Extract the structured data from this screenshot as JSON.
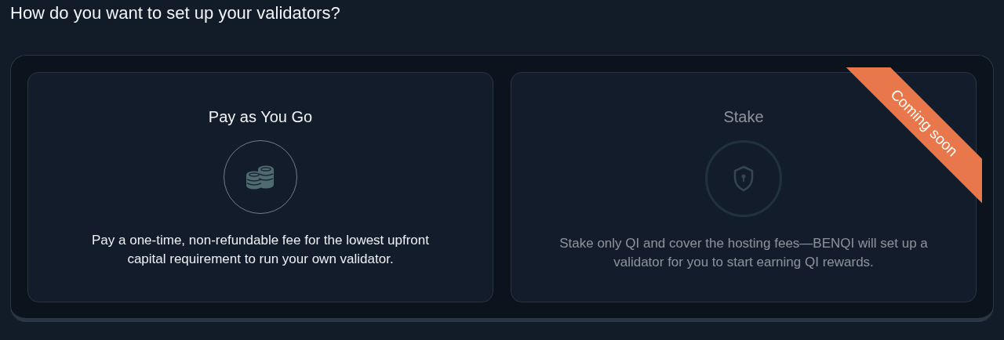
{
  "heading": "How do you want to set up your validators?",
  "options": [
    {
      "title": "Pay as You Go",
      "kind": "coins",
      "description": "Pay a one-time, non-refundable fee for the lowest upfront capital requirement to run your own validator.",
      "disabled": false
    },
    {
      "title": "Stake",
      "kind": "shield",
      "description": "Stake only QI and cover the hosting fees—BENQI will set up a validator for you to start earning QI rewards.",
      "disabled": true,
      "badge": "Coming soon"
    }
  ]
}
